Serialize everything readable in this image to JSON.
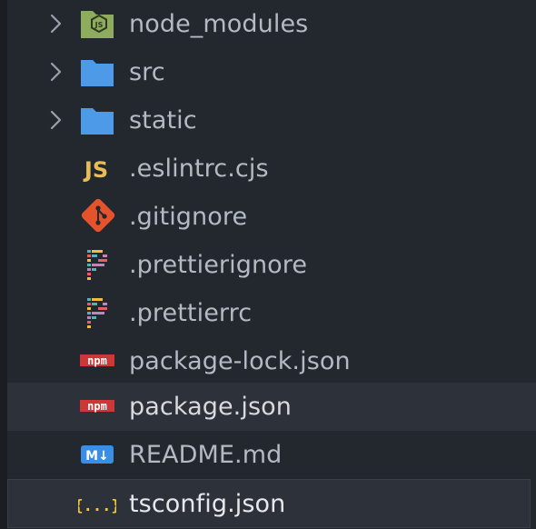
{
  "explorer": {
    "items": [
      {
        "label": "node_modules",
        "icon": "nodejs-folder-icon",
        "expandable": true
      },
      {
        "label": "src",
        "icon": "folder-icon",
        "expandable": true
      },
      {
        "label": "static",
        "icon": "folder-icon",
        "expandable": true
      },
      {
        "label": ".eslintrc.cjs",
        "icon": "javascript-icon",
        "expandable": false
      },
      {
        "label": ".gitignore",
        "icon": "git-icon",
        "expandable": false
      },
      {
        "label": ".prettierignore",
        "icon": "prettier-icon",
        "expandable": false
      },
      {
        "label": ".prettierrc",
        "icon": "prettier-icon",
        "expandable": false
      },
      {
        "label": "package-lock.json",
        "icon": "npm-icon",
        "expandable": false
      },
      {
        "label": "package.json",
        "icon": "npm-icon",
        "expandable": false,
        "state": "hover"
      },
      {
        "label": "README.md",
        "icon": "markdown-icon",
        "expandable": false
      },
      {
        "label": "tsconfig.json",
        "icon": "json-icon",
        "expandable": false,
        "state": "selected"
      }
    ],
    "icon_texts": {
      "js": "JS",
      "npm": "npm",
      "md": "M↓",
      "json": "{...}"
    },
    "colors": {
      "background": "#23272e",
      "text": "#b4bac4",
      "folder": "#4d9be8",
      "js": "#e8bd58",
      "git": "#e5532d",
      "npm": "#cb3837",
      "markdown": "#3a8ee6",
      "json": "#f0c33c",
      "node": "#8fab5e"
    }
  }
}
